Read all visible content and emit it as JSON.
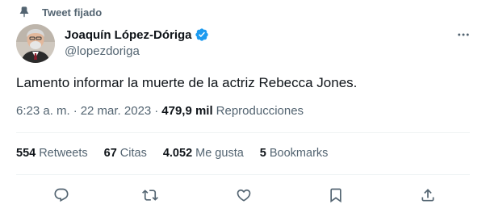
{
  "pinned": {
    "label": "Tweet fijado",
    "icon": "pin-icon"
  },
  "author": {
    "display_name": "Joaquín López-Dóriga",
    "handle": "@lopezdoriga",
    "verified": true,
    "verified_color": "#1d9bf0"
  },
  "tweet": {
    "text": "Lamento informar la muerte de la actriz Rebecca Jones.",
    "time": "6:23 a. m.",
    "separator": "·",
    "date": "22 mar. 2023",
    "views_count": "479,9 mil",
    "views_label": "Reproducciones"
  },
  "stats": {
    "retweets": {
      "count": "554",
      "label": "Retweets"
    },
    "quotes": {
      "count": "67",
      "label": "Citas"
    },
    "likes": {
      "count": "4.052",
      "label": "Me gusta"
    },
    "bookmarks": {
      "count": "5",
      "label": "Bookmarks"
    }
  },
  "actions": [
    "reply-icon",
    "retweet-icon",
    "like-icon",
    "bookmark-icon",
    "share-icon"
  ],
  "colors": {
    "text": "#0f1419",
    "secondary": "#536471",
    "divider": "#eff3f4",
    "accent": "#1d9bf0"
  }
}
